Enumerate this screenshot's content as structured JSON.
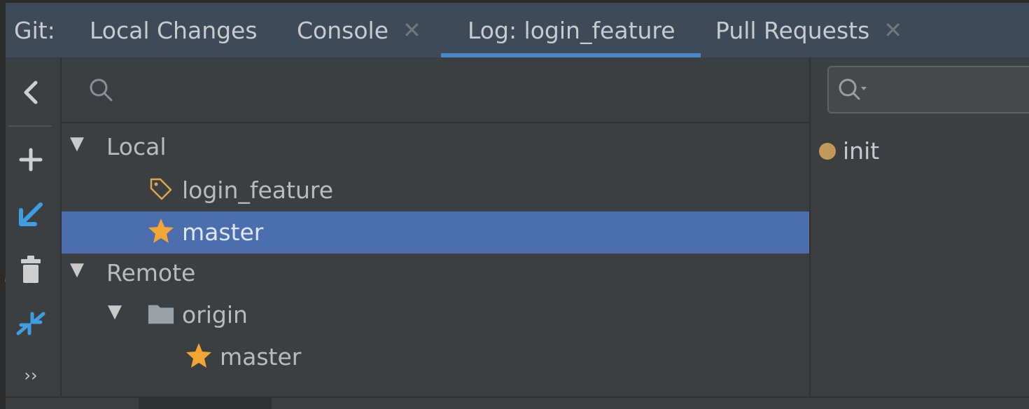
{
  "tabs": {
    "prefix": "Git:",
    "items": [
      {
        "label": "Local Changes"
      },
      {
        "label": "Console",
        "close": "✕"
      },
      {
        "label": "Log: login_feature"
      },
      {
        "label": "Pull Requests",
        "close": "✕"
      }
    ]
  },
  "toolbar": {
    "collapse": "back-arrow-icon",
    "buttons": [
      "add-icon",
      "checkout-arrow-icon",
      "delete-icon",
      "merge-icon"
    ],
    "more": "››"
  },
  "tree": {
    "local": {
      "label": "Local",
      "branches": [
        {
          "label": "login_feature",
          "icon": "tag-icon"
        },
        {
          "label": "master",
          "icon": "star-icon",
          "selected": true
        }
      ]
    },
    "remote": {
      "label": "Remote",
      "origin": {
        "label": "origin",
        "branches": [
          {
            "label": "master",
            "icon": "star-icon"
          }
        ]
      }
    }
  },
  "log": {
    "commits": [
      {
        "message": "init"
      }
    ]
  },
  "colors": {
    "accent": "#4a88c7",
    "selected": "#4b6eaf",
    "star": "#f2a633",
    "tag": "#d9a84a",
    "commit_dot": "#c19a5b"
  }
}
